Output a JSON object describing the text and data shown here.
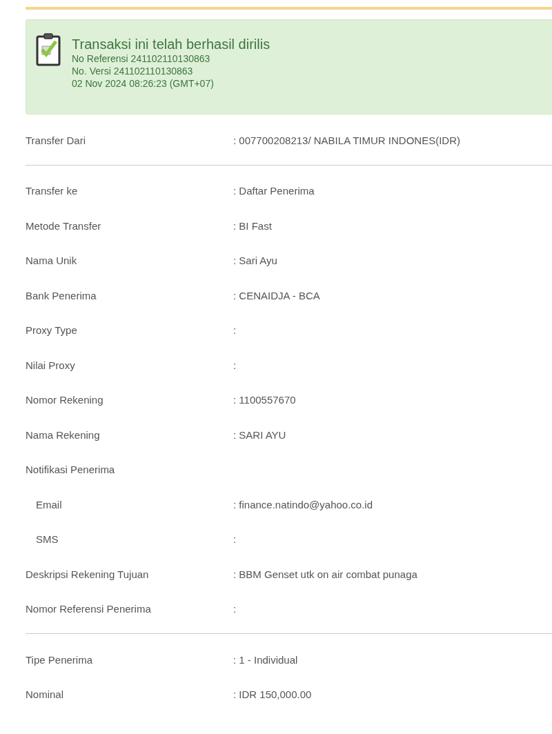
{
  "alert": {
    "title": "Transaksi ini telah berhasil dirilis",
    "lines": [
      "No Referensi 241102110130863",
      "No. Versi 241102110130863",
      "02 Nov 2024 08:26:23 (GMT+07)"
    ]
  },
  "sections": [
    {
      "rows": [
        {
          "label": "Transfer Dari",
          "value": ": 007700208213/ NABILA TIMUR INDONES(IDR)"
        }
      ]
    },
    {
      "rows": [
        {
          "label": "Transfer ke",
          "value": ": Daftar Penerima"
        },
        {
          "label": "Metode Transfer",
          "value": ": BI Fast"
        },
        {
          "label": "Nama Unik",
          "value": ": Sari Ayu"
        },
        {
          "label": "Bank Penerima",
          "value": ": CENAIDJA - BCA"
        },
        {
          "label": "Proxy Type",
          "value": ":"
        },
        {
          "label": "Nilai Proxy",
          "value": ":"
        },
        {
          "label": "Nomor Rekening",
          "value": ": 1100557670"
        },
        {
          "label": "Nama Rekening",
          "value": ": SARI AYU"
        },
        {
          "label": "Notifikasi Penerima",
          "children": [
            {
              "label": "Email",
              "value": ": finance.natindo@yahoo.co.id"
            },
            {
              "label": "SMS",
              "value": ":"
            }
          ]
        },
        {
          "label": "Deskripsi Rekening Tujuan",
          "value": ": BBM Genset utk on air combat punaga"
        },
        {
          "label": "Nomor Referensi Penerima",
          "value": ":"
        }
      ]
    },
    {
      "rows": [
        {
          "label": "Tipe Penerima",
          "value": ": 1 - Individual"
        },
        {
          "label": "Nominal",
          "value": ": IDR  150,000.00"
        }
      ]
    }
  ]
}
